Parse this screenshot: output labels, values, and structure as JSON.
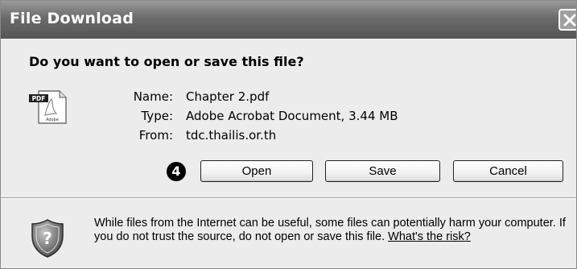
{
  "window": {
    "title": "File Download"
  },
  "dialog": {
    "question": "Do you want to open or save this file?",
    "file_icon": "pdf-document-icon",
    "file_icon_badge": "PDF",
    "file_icon_brand": "Adobe",
    "fields": [
      {
        "label": "Name:",
        "value": "Chapter 2.pdf"
      },
      {
        "label": "Type:",
        "value": "Adobe Acrobat Document, 3.44 MB"
      },
      {
        "label": "From:",
        "value": "tdc.thailis.or.th"
      }
    ],
    "step_marker": "4",
    "buttons": {
      "open": "Open",
      "save": "Save",
      "cancel": "Cancel"
    }
  },
  "warning": {
    "icon": "shield-question-icon",
    "text": "While files from the Internet can be useful, some files can potentially harm your computer. If you do not trust the source, do not open or save this file.",
    "link": "What's the risk?"
  }
}
